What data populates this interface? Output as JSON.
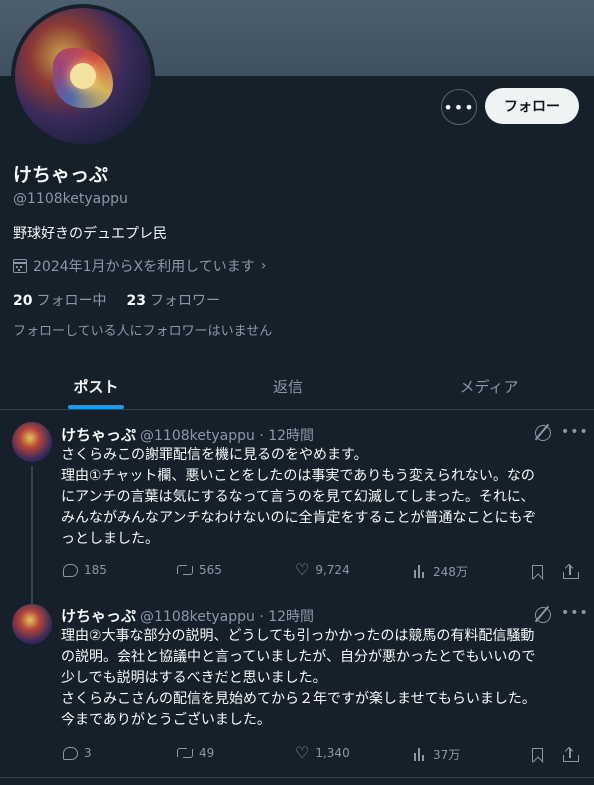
{
  "profile": {
    "display_name": "けちゃっぷ",
    "handle": "@1108ketyappu",
    "bio": "野球好きのデュエプレ民",
    "joined": "2024年1月からXを利用しています",
    "following_count": "20",
    "following_label": "フォロー中",
    "followers_count": "23",
    "followers_label": "フォロワー",
    "no_mutual_followers": "フォローしている人にフォロワーはいません",
    "follow_button": "フォロー",
    "more_button": "•••"
  },
  "tabs": [
    {
      "label": "ポスト",
      "active": true
    },
    {
      "label": "返信",
      "active": false
    },
    {
      "label": "メディア",
      "active": false
    }
  ],
  "posts": [
    {
      "name": "けちゃっぷ",
      "meta": "@1108ketyappu · 12時間",
      "text": "さくらみこの謝罪配信を機に見るのをやめます。\n理由①チャット欄、悪いことをしたのは事実でありもう変えられない。なの\nにアンチの言葉は気にするなって言うのを見て幻滅してしまった。それに、\nみんながみんなアンチなわけないのに全肯定をすることが普通なことにもぞ\nっとしました。",
      "replies": "185",
      "reposts": "565",
      "likes": "9,724",
      "views": "248万"
    },
    {
      "name": "けちゃっぷ",
      "meta": "@1108ketyappu · 12時間",
      "text": "理由②大事な部分の説明、どうしても引っかかったのは競馬の有料配信騒動\nの説明。会社と協議中と言っていましたが、自分が悪かったとでもいいので\n少しでも説明はするべきだと思いました。\nさくらみこさんの配信を見始めてから２年ですが楽しませてもらいました。\n今までありがとうございました。",
      "replies": "3",
      "reposts": "49",
      "likes": "1,340",
      "views": "37万"
    }
  ],
  "colors": {
    "background": "#15202b",
    "accent": "#1d9bf0",
    "secondary_text": "#8b98a5",
    "border": "#38444d"
  },
  "icons": {
    "post_menu": "•••",
    "like": "♡",
    "joined_chevron": "›"
  }
}
